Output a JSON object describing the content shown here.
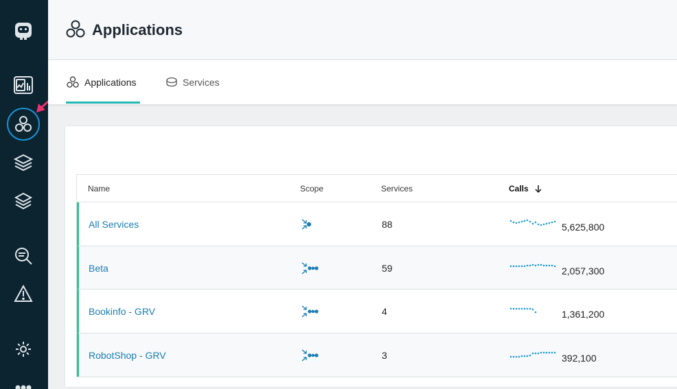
{
  "header": {
    "title": "Applications",
    "icon": "applications-icon"
  },
  "sidebar": {
    "items": [
      {
        "name": "logo",
        "icon": "robot-logo-icon"
      },
      {
        "name": "dashboards",
        "icon": "dashboard-icon"
      },
      {
        "name": "applications",
        "icon": "applications-icon",
        "active": true
      },
      {
        "name": "platforms",
        "icon": "platforms-icon"
      },
      {
        "name": "infrastructure",
        "icon": "layers-icon"
      },
      {
        "name": "analytics",
        "icon": "search-analytics-icon"
      },
      {
        "name": "events",
        "icon": "warning-icon"
      },
      {
        "name": "settings",
        "icon": "gear-icon"
      },
      {
        "name": "more",
        "icon": "more-icon"
      }
    ]
  },
  "tabs": [
    {
      "label": "Applications",
      "icon": "applications-icon",
      "active": true
    },
    {
      "label": "Services",
      "icon": "database-icon",
      "active": false
    }
  ],
  "table": {
    "columns": {
      "name": "Name",
      "scope": "Scope",
      "services": "Services",
      "calls": "Calls"
    },
    "sort": {
      "column": "calls",
      "direction": "desc"
    },
    "rows": [
      {
        "name": "All Services",
        "scope_icon": "scope-inbound-icon",
        "services": "88",
        "calls": "5,625,800"
      },
      {
        "name": "Beta",
        "scope_icon": "scope-downstream-icon",
        "services": "59",
        "calls": "2,057,300"
      },
      {
        "name": "Bookinfo - GRV",
        "scope_icon": "scope-downstream-icon",
        "services": "4",
        "calls": "1,361,200"
      },
      {
        "name": "RobotShop - GRV",
        "scope_icon": "scope-downstream-icon",
        "services": "3",
        "calls": "392,100"
      }
    ]
  },
  "colors": {
    "sidebar_bg": "#0c2330",
    "accent": "#23b7b4",
    "link": "#1a7db5",
    "row_marker": "#2ec28d",
    "annotation_arrow": "#e8336d"
  }
}
